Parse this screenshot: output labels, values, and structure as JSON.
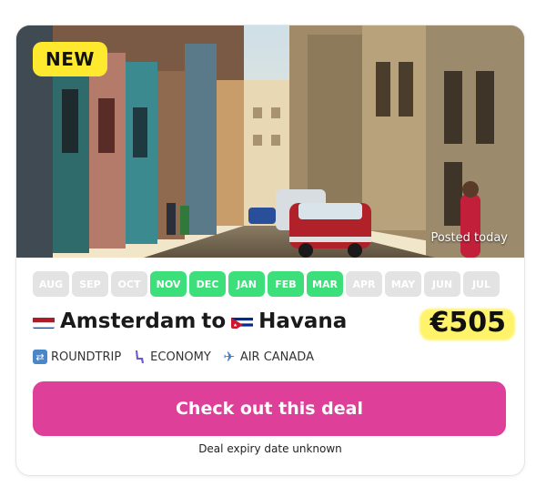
{
  "card": {
    "badge": "NEW",
    "posted": "Posted today",
    "months": [
      {
        "label": "AUG",
        "active": false
      },
      {
        "label": "SEP",
        "active": false
      },
      {
        "label": "OCT",
        "active": false
      },
      {
        "label": "NOV",
        "active": true
      },
      {
        "label": "DEC",
        "active": true
      },
      {
        "label": "JAN",
        "active": true
      },
      {
        "label": "FEB",
        "active": true
      },
      {
        "label": "MAR",
        "active": true
      },
      {
        "label": "APR",
        "active": false
      },
      {
        "label": "MAY",
        "active": false
      },
      {
        "label": "JUN",
        "active": false
      },
      {
        "label": "JUL",
        "active": false
      }
    ],
    "origin": "Amsterdam",
    "connector": "to",
    "destination": "Havana",
    "price": "€505",
    "trip_type": "ROUNDTRIP",
    "cabin": "ECONOMY",
    "airline": "AIR CANADA",
    "cta_label": "Check out this deal",
    "expiry": "Deal expiry date unknown"
  },
  "colors": {
    "accent": "#de3f98",
    "active_month": "#3ddf7a",
    "inactive_month": "#e3e3e3",
    "badge": "#ffe92e",
    "price_highlight": "#fff36a"
  },
  "icons": {
    "trip_type": "roundtrip-icon",
    "cabin": "seat-icon",
    "airline": "airplane-icon"
  }
}
